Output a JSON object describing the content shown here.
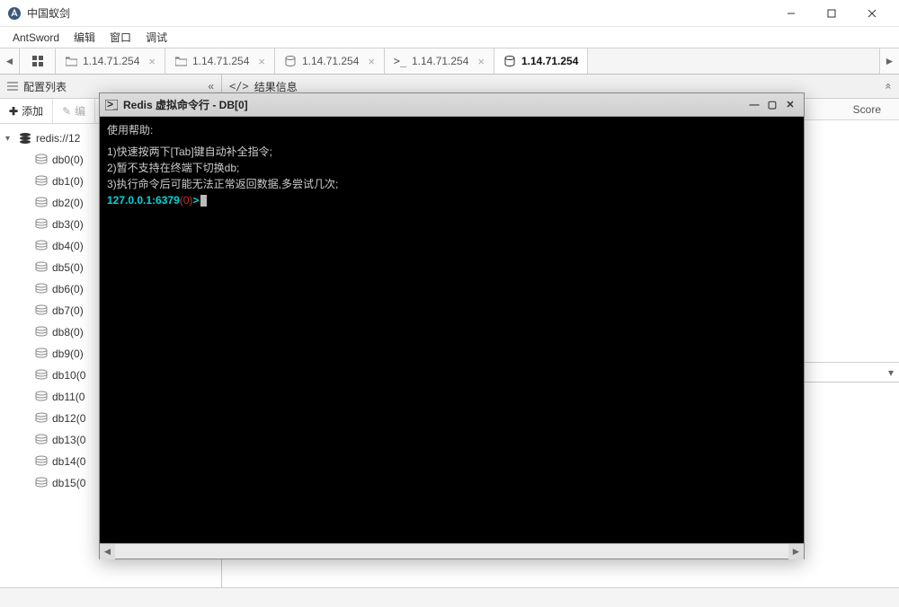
{
  "window": {
    "title": "中国蚁剑"
  },
  "menu": {
    "app": "AntSword",
    "edit": "编辑",
    "window": "窗口",
    "debug": "调试"
  },
  "tabs": {
    "items": [
      {
        "label": "1.14.71.254",
        "icon": "folder"
      },
      {
        "label": "1.14.71.254",
        "icon": "folder"
      },
      {
        "label": "1.14.71.254",
        "icon": "db"
      },
      {
        "label": "1.14.71.254",
        "icon": "prompt"
      },
      {
        "label": "1.14.71.254",
        "icon": "db",
        "active": true
      }
    ]
  },
  "leftPanel": {
    "title": "配置列表",
    "addBtn": "添加",
    "editBtn": "编",
    "rootLabel": "redis://12",
    "dbs": [
      "db0(0)",
      "db1(0)",
      "db2(0)",
      "db3(0)",
      "db4(0)",
      "db5(0)",
      "db6(0)",
      "db7(0)",
      "db8(0)",
      "db9(0)",
      "db10(0",
      "db11(0",
      "db12(0",
      "db13(0",
      "db14(0",
      "db15(0"
    ]
  },
  "rightPanel": {
    "title": "结果信息",
    "scoreCol": "Score"
  },
  "modal": {
    "title": "Redis 虚拟命令行 - DB[0]",
    "helpHeader": "使用帮助:",
    "line1": "1)快速按两下[Tab]键自动补全指令;",
    "line2": "2)暂不支持在终端下切换db;",
    "line3": "3)执行命令后可能无法正常返回数据,多尝试几次;",
    "promptHost": "127.0.0.1:6379",
    "promptDb": "(0)",
    "promptEnd": ">"
  }
}
